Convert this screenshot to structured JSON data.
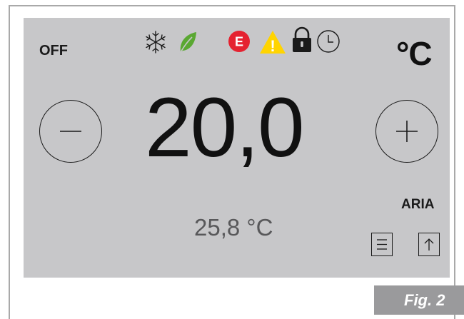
{
  "status": {
    "mode": "OFF"
  },
  "icons": [
    "snowflake-icon",
    "leaf-icon",
    "error-icon",
    "warning-icon",
    "lock-icon",
    "clock-icon"
  ],
  "error_icon_letter": "E",
  "warning_icon_mark": "!",
  "unit": "°C",
  "setpoint": "20,0",
  "measured_temperature": "25,8 °C",
  "sensor_label": "ARIA",
  "colors": {
    "screen_bg": "#c7c7c9",
    "error_red": "#e52230",
    "warning_yellow": "#ffd400",
    "leaf_green": "#5aa832",
    "caption_bg": "#9a9a9c"
  },
  "caption": "Fig. 2"
}
